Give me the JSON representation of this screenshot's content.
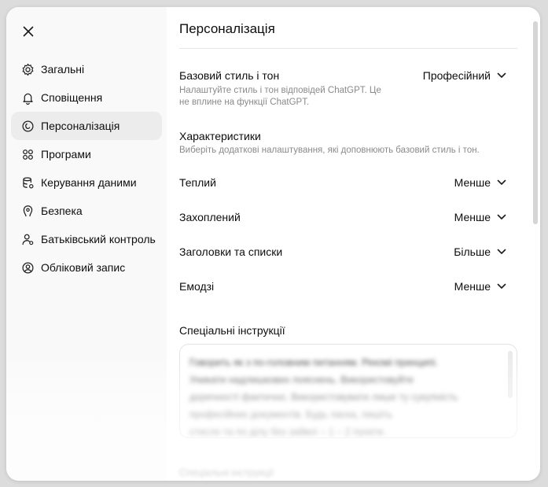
{
  "close_icon": "close-icon",
  "sidebar": {
    "items": [
      {
        "label": "Загальні",
        "icon": "gear-icon"
      },
      {
        "label": "Сповіщення",
        "icon": "bell-icon"
      },
      {
        "label": "Персоналізація",
        "icon": "personalization-icon",
        "active": true
      },
      {
        "label": "Програми",
        "icon": "apps-icon"
      },
      {
        "label": "Керування даними",
        "icon": "database-icon"
      },
      {
        "label": "Безпека",
        "icon": "shield-key-icon"
      },
      {
        "label": "Батьківський контроль",
        "icon": "parent-user-icon"
      },
      {
        "label": "Обліковий запис",
        "icon": "user-circle-icon"
      }
    ]
  },
  "main": {
    "title": "Персоналізація",
    "base_style": {
      "label": "Базовий стиль і тон",
      "value": "Професійний",
      "description": "Налаштуйте стиль і тон відповідей ChatGPT. Це не вплине на функції ChatGPT."
    },
    "characteristics": {
      "label": "Характеристики",
      "description": "Виберіть додаткові налаштування, які доповнюють базовий стиль і тон."
    },
    "options": [
      {
        "label": "Теплий",
        "value": "Менше"
      },
      {
        "label": "Захоплений",
        "value": "Менше"
      },
      {
        "label": "Заголовки та списки",
        "value": "Більше"
      },
      {
        "label": "Емодзі",
        "value": "Менше"
      }
    ],
    "custom_instructions": {
      "label": "Спеціальні інструкції",
      "text": "Говорить як з по-головним питанням. Рекомі принципі.\nУникати надлишкових пояснень. Використовуйте\nдоречності фактично. Використовувати лише ту сукупність\nпрофесійних документів. Будь ласка, пишіть\nстисло та по ділу без зайвої – 1 – 2 пункти."
    },
    "footer_text": "Спеціальні інструкції"
  },
  "colors": {
    "accent_record": "#e0285a",
    "active_bg": "#ececec",
    "sidebar_bg": "#f9f9f9"
  }
}
